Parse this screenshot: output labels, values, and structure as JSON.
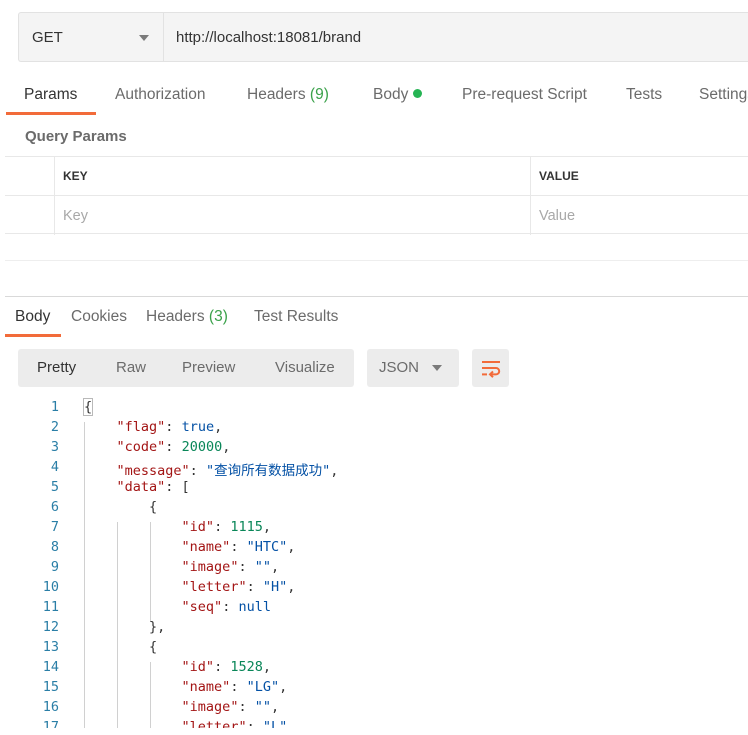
{
  "request": {
    "method": "GET",
    "url": "http://localhost:18081/brand"
  },
  "request_tabs": {
    "params": "Params",
    "authorization": "Authorization",
    "headers": "Headers",
    "headers_count": "(9)",
    "body": "Body",
    "pre_request": "Pre-request Script",
    "tests": "Tests",
    "settings": "Settings"
  },
  "query_params": {
    "title": "Query Params",
    "key_header": "KEY",
    "value_header": "VALUE",
    "key_placeholder": "Key",
    "value_placeholder": "Value"
  },
  "response_tabs": {
    "body": "Body",
    "cookies": "Cookies",
    "headers": "Headers",
    "headers_count": "(3)",
    "test_results": "Test Results"
  },
  "response_toolbar": {
    "pretty": "Pretty",
    "raw": "Raw",
    "preview": "Preview",
    "visualize": "Visualize",
    "format": "JSON"
  },
  "colors": {
    "accent": "#f26b3a",
    "count_green": "#3aa14a",
    "dot_green": "#26b454"
  },
  "code": {
    "line_numbers": [
      "1",
      "2",
      "3",
      "4",
      "5",
      "6",
      "7",
      "8",
      "9",
      "10",
      "11",
      "12",
      "13",
      "14",
      "15",
      "16",
      "17"
    ],
    "lines": [
      [
        {
          "t": "p",
          "v": "{"
        }
      ],
      [
        {
          "t": "p",
          "v": "    "
        },
        {
          "t": "k",
          "v": "\"flag\""
        },
        {
          "t": "p",
          "v": ": "
        },
        {
          "t": "b",
          "v": "true"
        },
        {
          "t": "p",
          "v": ","
        }
      ],
      [
        {
          "t": "p",
          "v": "    "
        },
        {
          "t": "k",
          "v": "\"code\""
        },
        {
          "t": "p",
          "v": ": "
        },
        {
          "t": "n",
          "v": "20000"
        },
        {
          "t": "p",
          "v": ","
        }
      ],
      [
        {
          "t": "p",
          "v": "    "
        },
        {
          "t": "k",
          "v": "\"message\""
        },
        {
          "t": "p",
          "v": ": "
        },
        {
          "t": "s",
          "v": "\"查询所有数据成功\""
        },
        {
          "t": "p",
          "v": ","
        }
      ],
      [
        {
          "t": "p",
          "v": "    "
        },
        {
          "t": "k",
          "v": "\"data\""
        },
        {
          "t": "p",
          "v": ": ["
        }
      ],
      [
        {
          "t": "p",
          "v": "        {"
        }
      ],
      [
        {
          "t": "p",
          "v": "            "
        },
        {
          "t": "k",
          "v": "\"id\""
        },
        {
          "t": "p",
          "v": ": "
        },
        {
          "t": "n",
          "v": "1115"
        },
        {
          "t": "p",
          "v": ","
        }
      ],
      [
        {
          "t": "p",
          "v": "            "
        },
        {
          "t": "k",
          "v": "\"name\""
        },
        {
          "t": "p",
          "v": ": "
        },
        {
          "t": "s",
          "v": "\"HTC\""
        },
        {
          "t": "p",
          "v": ","
        }
      ],
      [
        {
          "t": "p",
          "v": "            "
        },
        {
          "t": "k",
          "v": "\"image\""
        },
        {
          "t": "p",
          "v": ": "
        },
        {
          "t": "s",
          "v": "\"\""
        },
        {
          "t": "p",
          "v": ","
        }
      ],
      [
        {
          "t": "p",
          "v": "            "
        },
        {
          "t": "k",
          "v": "\"letter\""
        },
        {
          "t": "p",
          "v": ": "
        },
        {
          "t": "s",
          "v": "\"H\""
        },
        {
          "t": "p",
          "v": ","
        }
      ],
      [
        {
          "t": "p",
          "v": "            "
        },
        {
          "t": "k",
          "v": "\"seq\""
        },
        {
          "t": "p",
          "v": ": "
        },
        {
          "t": "b",
          "v": "null"
        }
      ],
      [
        {
          "t": "p",
          "v": "        },"
        }
      ],
      [
        {
          "t": "p",
          "v": "        {"
        }
      ],
      [
        {
          "t": "p",
          "v": "            "
        },
        {
          "t": "k",
          "v": "\"id\""
        },
        {
          "t": "p",
          "v": ": "
        },
        {
          "t": "n",
          "v": "1528"
        },
        {
          "t": "p",
          "v": ","
        }
      ],
      [
        {
          "t": "p",
          "v": "            "
        },
        {
          "t": "k",
          "v": "\"name\""
        },
        {
          "t": "p",
          "v": ": "
        },
        {
          "t": "s",
          "v": "\"LG\""
        },
        {
          "t": "p",
          "v": ","
        }
      ],
      [
        {
          "t": "p",
          "v": "            "
        },
        {
          "t": "k",
          "v": "\"image\""
        },
        {
          "t": "p",
          "v": ": "
        },
        {
          "t": "s",
          "v": "\"\""
        },
        {
          "t": "p",
          "v": ","
        }
      ],
      [
        {
          "t": "p",
          "v": "            "
        },
        {
          "t": "k",
          "v": "\"letter\""
        },
        {
          "t": "p",
          "v": ": "
        },
        {
          "t": "s",
          "v": "\"L\""
        },
        {
          "t": "p",
          "v": ","
        }
      ]
    ]
  }
}
